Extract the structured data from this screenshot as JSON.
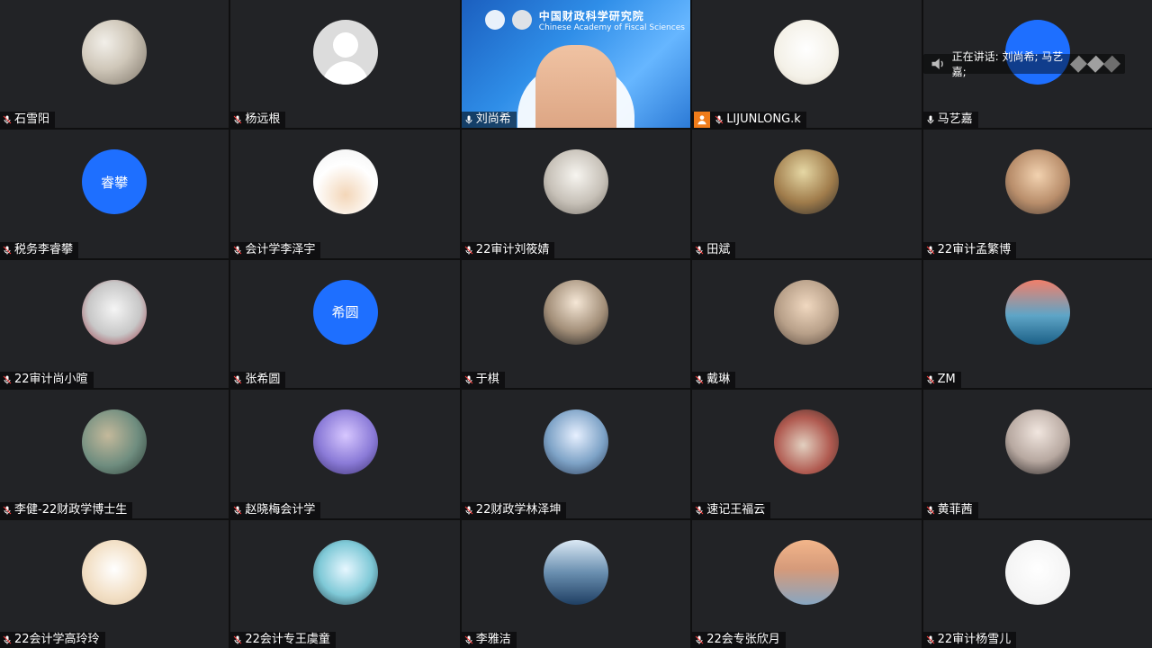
{
  "tiles": [
    {
      "name": "石雪阳",
      "type": "photo",
      "mic": "muted"
    },
    {
      "name": "杨远根",
      "type": "gray",
      "mic": "muted"
    },
    {
      "name": "刘尚希",
      "type": "video",
      "mic": "on"
    },
    {
      "name": "LIJUNLONG.k",
      "type": "photo",
      "mic": "muted",
      "badge": "person"
    },
    {
      "name": "马艺嘉",
      "type": "text",
      "avatar_text": "",
      "mic": "on"
    },
    {
      "name": "税务李睿攀",
      "type": "text",
      "avatar_text": "睿攀",
      "mic": "muted"
    },
    {
      "name": "会计学李泽宇",
      "type": "photo",
      "mic": "muted"
    },
    {
      "name": "22审计刘筱婧",
      "type": "photo",
      "mic": "muted"
    },
    {
      "name": "田斌",
      "type": "photo",
      "mic": "muted"
    },
    {
      "name": "22审计孟繁博",
      "type": "photo",
      "mic": "muted"
    },
    {
      "name": "22审计尚小暄",
      "type": "photo",
      "mic": "muted"
    },
    {
      "name": "张希圆",
      "type": "text",
      "avatar_text": "希圆",
      "mic": "muted"
    },
    {
      "name": "于棋",
      "type": "photo",
      "mic": "muted"
    },
    {
      "name": "戴琳",
      "type": "photo",
      "mic": "muted"
    },
    {
      "name": "ZM",
      "type": "photo",
      "mic": "muted"
    },
    {
      "name": "李健-22财政学博士生",
      "type": "photo",
      "mic": "muted"
    },
    {
      "name": "赵晓梅会计学",
      "type": "photo",
      "mic": "muted"
    },
    {
      "name": "22财政学林泽坤",
      "type": "photo",
      "mic": "muted"
    },
    {
      "name": "速记王福云",
      "type": "photo",
      "mic": "muted"
    },
    {
      "name": "黄菲茜",
      "type": "photo",
      "mic": "muted"
    },
    {
      "name": "22会计学高玲玲",
      "type": "photo",
      "mic": "muted"
    },
    {
      "name": "22会计专王虞童",
      "type": "photo",
      "mic": "muted"
    },
    {
      "name": "李雅洁",
      "type": "photo",
      "mic": "muted"
    },
    {
      "name": "22会专张欣月",
      "type": "photo",
      "mic": "muted"
    },
    {
      "name": "22审计杨雪儿",
      "type": "photo",
      "mic": "muted"
    }
  ],
  "video_banner": {
    "title": "中国财政科学研究院",
    "subtitle": "Chinese Academy of Fiscal Sciences"
  },
  "speaking_label": "正在讲话: 刘尚希; 马艺嘉;",
  "colors": {
    "tile_bg": "#222326",
    "avatar_blue": "#1e6fff",
    "badge_orange": "#f07c1a",
    "active_border": "#2b7cff"
  },
  "icons": {
    "mic_on": "microphone-icon",
    "mic_muted": "microphone-muted-icon",
    "badge": "person-badge-icon"
  }
}
